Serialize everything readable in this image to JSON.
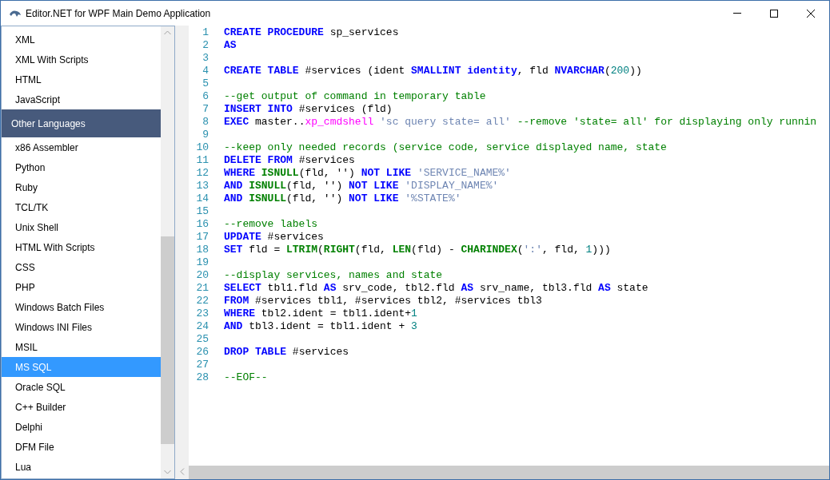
{
  "window": {
    "title": "Editor.NET for WPF Main Demo Application"
  },
  "sidebar": {
    "items": [
      {
        "kind": "item",
        "label": "XML",
        "selected": false
      },
      {
        "kind": "item",
        "label": "XML With Scripts",
        "selected": false
      },
      {
        "kind": "item",
        "label": "HTML",
        "selected": false
      },
      {
        "kind": "item",
        "label": "JavaScript",
        "selected": false
      },
      {
        "kind": "header",
        "label": "Other Languages"
      },
      {
        "kind": "item",
        "label": "x86 Assembler",
        "selected": false
      },
      {
        "kind": "item",
        "label": "Python",
        "selected": false
      },
      {
        "kind": "item",
        "label": "Ruby",
        "selected": false
      },
      {
        "kind": "item",
        "label": "TCL/TK",
        "selected": false
      },
      {
        "kind": "item",
        "label": "Unix Shell",
        "selected": false
      },
      {
        "kind": "item",
        "label": "HTML With Scripts",
        "selected": false
      },
      {
        "kind": "item",
        "label": "CSS",
        "selected": false
      },
      {
        "kind": "item",
        "label": "PHP",
        "selected": false
      },
      {
        "kind": "item",
        "label": "Windows Batch Files",
        "selected": false
      },
      {
        "kind": "item",
        "label": "Windows INI Files",
        "selected": false
      },
      {
        "kind": "item",
        "label": "MSIL",
        "selected": false
      },
      {
        "kind": "item",
        "label": "MS SQL",
        "selected": true
      },
      {
        "kind": "item",
        "label": "Oracle SQL",
        "selected": false
      },
      {
        "kind": "item",
        "label": "C++ Builder",
        "selected": false
      },
      {
        "kind": "item",
        "label": "Delphi",
        "selected": false
      },
      {
        "kind": "item",
        "label": "DFM File",
        "selected": false
      },
      {
        "kind": "item",
        "label": "Lua",
        "selected": false
      }
    ]
  },
  "editor": {
    "lines": [
      {
        "number": "1",
        "tokens": [
          {
            "kind": "keyword",
            "text": "CREATE "
          },
          {
            "kind": "keyword",
            "text": "PROCEDURE"
          },
          {
            "kind": "plain",
            "text": " sp_services"
          }
        ]
      },
      {
        "number": "2",
        "tokens": [
          {
            "kind": "keyword",
            "text": "AS"
          }
        ]
      },
      {
        "number": "3"
      },
      {
        "number": "4",
        "tokens": [
          {
            "kind": "keyword",
            "text": "CREATE "
          },
          {
            "kind": "keyword",
            "text": "TABLE"
          },
          {
            "kind": "plain",
            "text": " #services (ident "
          },
          {
            "kind": "keyword",
            "text": "SMALLINT "
          },
          {
            "kind": "keyword",
            "text": "identity"
          },
          {
            "kind": "plain",
            "text": ", fld "
          },
          {
            "kind": "keyword",
            "text": "NVARCHAR"
          },
          {
            "kind": "plain",
            "text": "("
          },
          {
            "kind": "number",
            "text": "200"
          },
          {
            "kind": "plain",
            "text": "))"
          }
        ]
      },
      {
        "number": "5"
      },
      {
        "number": "6",
        "tokens": [
          {
            "kind": "comment",
            "text": "--get output of command in temporary table"
          }
        ]
      },
      {
        "number": "7",
        "tokens": [
          {
            "kind": "keyword",
            "text": "INSERT "
          },
          {
            "kind": "keyword",
            "text": "INTO"
          },
          {
            "kind": "plain",
            "text": " #services (fld)"
          }
        ]
      },
      {
        "number": "8",
        "tokens": [
          {
            "kind": "keyword",
            "text": "EXEC"
          },
          {
            "kind": "plain",
            "text": " master.."
          },
          {
            "kind": "sysproc",
            "text": "xp_cmdshell"
          },
          {
            "kind": "string",
            "text": " 'sc query state= all'"
          },
          {
            "kind": "comment",
            "text": " --remove 'state= all' for displaying only runnin"
          }
        ]
      },
      {
        "number": "9"
      },
      {
        "number": "10",
        "tokens": [
          {
            "kind": "comment",
            "text": "--keep only needed records (service code, service displayed name, state"
          }
        ]
      },
      {
        "number": "11",
        "tokens": [
          {
            "kind": "keyword",
            "text": "DELETE "
          },
          {
            "kind": "keyword",
            "text": "FROM"
          },
          {
            "kind": "plain",
            "text": " #services"
          }
        ]
      },
      {
        "number": "12",
        "tokens": [
          {
            "kind": "keyword",
            "text": "WHERE "
          },
          {
            "kind": "function",
            "text": "ISNULL"
          },
          {
            "kind": "plain",
            "text": "(fld, '') "
          },
          {
            "kind": "keyword",
            "text": "NOT "
          },
          {
            "kind": "keyword",
            "text": "LIKE "
          },
          {
            "kind": "string",
            "text": "'SERVICE_NAME%'"
          }
        ]
      },
      {
        "number": "13",
        "tokens": [
          {
            "kind": "keyword",
            "text": "AND "
          },
          {
            "kind": "function",
            "text": "ISNULL"
          },
          {
            "kind": "plain",
            "text": "(fld, '') "
          },
          {
            "kind": "keyword",
            "text": "NOT "
          },
          {
            "kind": "keyword",
            "text": "LIKE "
          },
          {
            "kind": "string",
            "text": "'DISPLAY_NAME%'"
          }
        ]
      },
      {
        "number": "14",
        "tokens": [
          {
            "kind": "keyword",
            "text": "AND "
          },
          {
            "kind": "function",
            "text": "ISNULL"
          },
          {
            "kind": "plain",
            "text": "(fld, '') "
          },
          {
            "kind": "keyword",
            "text": "NOT "
          },
          {
            "kind": "keyword",
            "text": "LIKE "
          },
          {
            "kind": "string",
            "text": "'%STATE%'"
          }
        ]
      },
      {
        "number": "15"
      },
      {
        "number": "16",
        "tokens": [
          {
            "kind": "comment",
            "text": "--remove labels"
          }
        ]
      },
      {
        "number": "17",
        "tokens": [
          {
            "kind": "keyword",
            "text": "UPDATE"
          },
          {
            "kind": "plain",
            "text": " #services"
          }
        ]
      },
      {
        "number": "18",
        "tokens": [
          {
            "kind": "keyword",
            "text": "SET"
          },
          {
            "kind": "plain",
            "text": " fld = "
          },
          {
            "kind": "function",
            "text": "LTRIM"
          },
          {
            "kind": "plain",
            "text": "("
          },
          {
            "kind": "function",
            "text": "RIGHT"
          },
          {
            "kind": "plain",
            "text": "(fld, "
          },
          {
            "kind": "function",
            "text": "LEN"
          },
          {
            "kind": "plain",
            "text": "(fld) - "
          },
          {
            "kind": "function",
            "text": "CHARINDEX"
          },
          {
            "kind": "plain",
            "text": "("
          },
          {
            "kind": "string",
            "text": "':'"
          },
          {
            "kind": "plain",
            "text": ", fld, "
          },
          {
            "kind": "number",
            "text": "1"
          },
          {
            "kind": "plain",
            "text": ")))"
          }
        ]
      },
      {
        "number": "19"
      },
      {
        "number": "20",
        "tokens": [
          {
            "kind": "comment",
            "text": "--display services, names and state"
          }
        ]
      },
      {
        "number": "21",
        "tokens": [
          {
            "kind": "keyword",
            "text": "SELECT"
          },
          {
            "kind": "plain",
            "text": " tbl1.fld "
          },
          {
            "kind": "keyword",
            "text": "AS"
          },
          {
            "kind": "plain",
            "text": " srv_code, tbl2.fld "
          },
          {
            "kind": "keyword",
            "text": "AS"
          },
          {
            "kind": "plain",
            "text": " srv_name, tbl3.fld "
          },
          {
            "kind": "keyword",
            "text": "AS"
          },
          {
            "kind": "plain",
            "text": " state"
          }
        ]
      },
      {
        "number": "22",
        "tokens": [
          {
            "kind": "keyword",
            "text": "FROM"
          },
          {
            "kind": "plain",
            "text": " #services tbl1, #services tbl2, #services tbl3"
          }
        ]
      },
      {
        "number": "23",
        "tokens": [
          {
            "kind": "keyword",
            "text": "WHERE"
          },
          {
            "kind": "plain",
            "text": " tbl2.ident = tbl1.ident+"
          },
          {
            "kind": "number",
            "text": "1"
          }
        ]
      },
      {
        "number": "24",
        "tokens": [
          {
            "kind": "keyword",
            "text": "AND"
          },
          {
            "kind": "plain",
            "text": " tbl3.ident = tbl1.ident + "
          },
          {
            "kind": "number",
            "text": "3"
          }
        ]
      },
      {
        "number": "25"
      },
      {
        "number": "26",
        "tokens": [
          {
            "kind": "keyword",
            "text": "DROP "
          },
          {
            "kind": "keyword",
            "text": "TABLE"
          },
          {
            "kind": "plain",
            "text": " #services"
          }
        ]
      },
      {
        "number": "27"
      },
      {
        "number": "28",
        "tokens": [
          {
            "kind": "comment",
            "text": "--EOF--"
          }
        ]
      }
    ]
  }
}
